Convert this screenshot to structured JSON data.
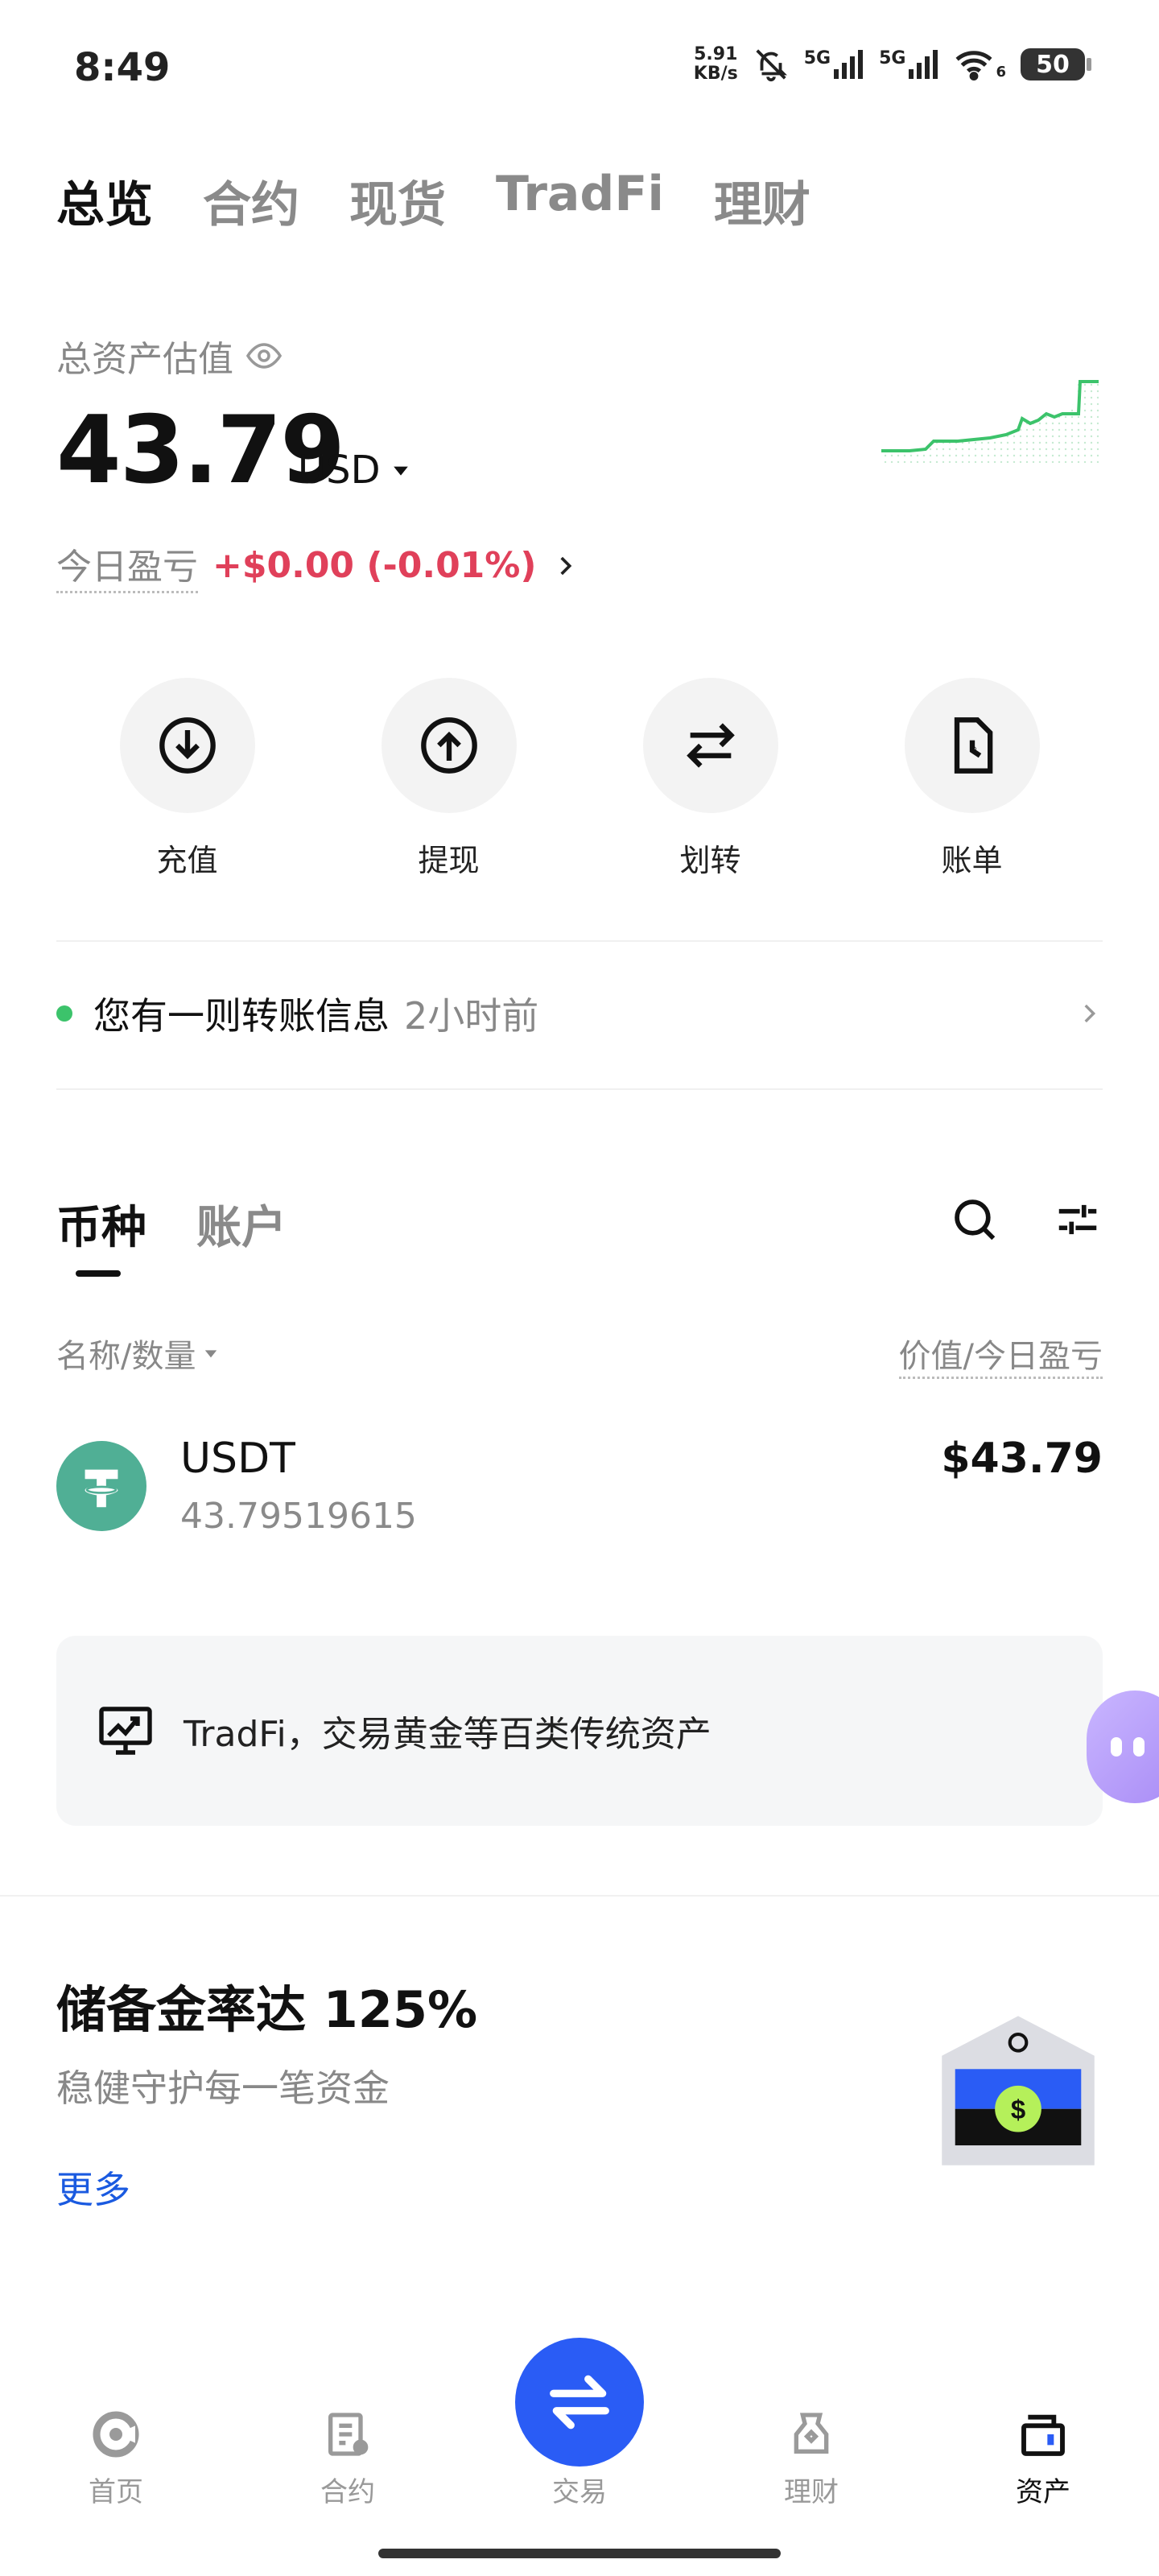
{
  "status_bar": {
    "time": "8:49",
    "net_speed": "5.91",
    "net_unit": "KB/s",
    "sig1": "5G",
    "sig2": "5G",
    "wifi_sub": "6",
    "battery": "50"
  },
  "top_tabs": [
    {
      "label": "总览",
      "active": true
    },
    {
      "label": "合约",
      "active": false
    },
    {
      "label": "现货",
      "active": false
    },
    {
      "label": "TradFi",
      "active": false
    },
    {
      "label": "理财",
      "active": false
    }
  ],
  "overview": {
    "total_label": "总资产估值",
    "total_value": "43.79",
    "currency": "USD",
    "pnl_label": "今日盈亏",
    "pnl_value": "+$0.00 (-0.01%)",
    "accent_up": "#3cc36b",
    "accent_down": "#e0405a"
  },
  "actions": [
    {
      "label": "充值",
      "icon": "deposit-icon"
    },
    {
      "label": "提现",
      "icon": "withdraw-icon"
    },
    {
      "label": "划转",
      "icon": "transfer-icon"
    },
    {
      "label": "账单",
      "icon": "bill-icon"
    }
  ],
  "notice": {
    "text": "您有一则转账信息",
    "time": "2小时前"
  },
  "coin_tabs": [
    {
      "label": "币种",
      "active": true
    },
    {
      "label": "账户",
      "active": false
    }
  ],
  "columns": {
    "left": "名称/数量",
    "right": "价值/今日盈亏"
  },
  "assets": [
    {
      "name": "USDT",
      "quantity": "43.79519615",
      "value": "$43.79",
      "icon": "tether-icon"
    }
  ],
  "banner": {
    "text": "TradFi，交易黄金等百类传统资产"
  },
  "reserve": {
    "title": "储备金率达 125%",
    "subtitle": "稳健守护每一笔资金",
    "more": "更多"
  },
  "nav": [
    {
      "label": "首页",
      "active": false
    },
    {
      "label": "合约",
      "active": false
    },
    {
      "label": "交易",
      "active": false
    },
    {
      "label": "理财",
      "active": false
    },
    {
      "label": "资产",
      "active": true
    }
  ],
  "colors": {
    "brand_blue": "#2a5cf5",
    "link_blue": "#1a5ae0",
    "tether_green": "#50af95"
  }
}
